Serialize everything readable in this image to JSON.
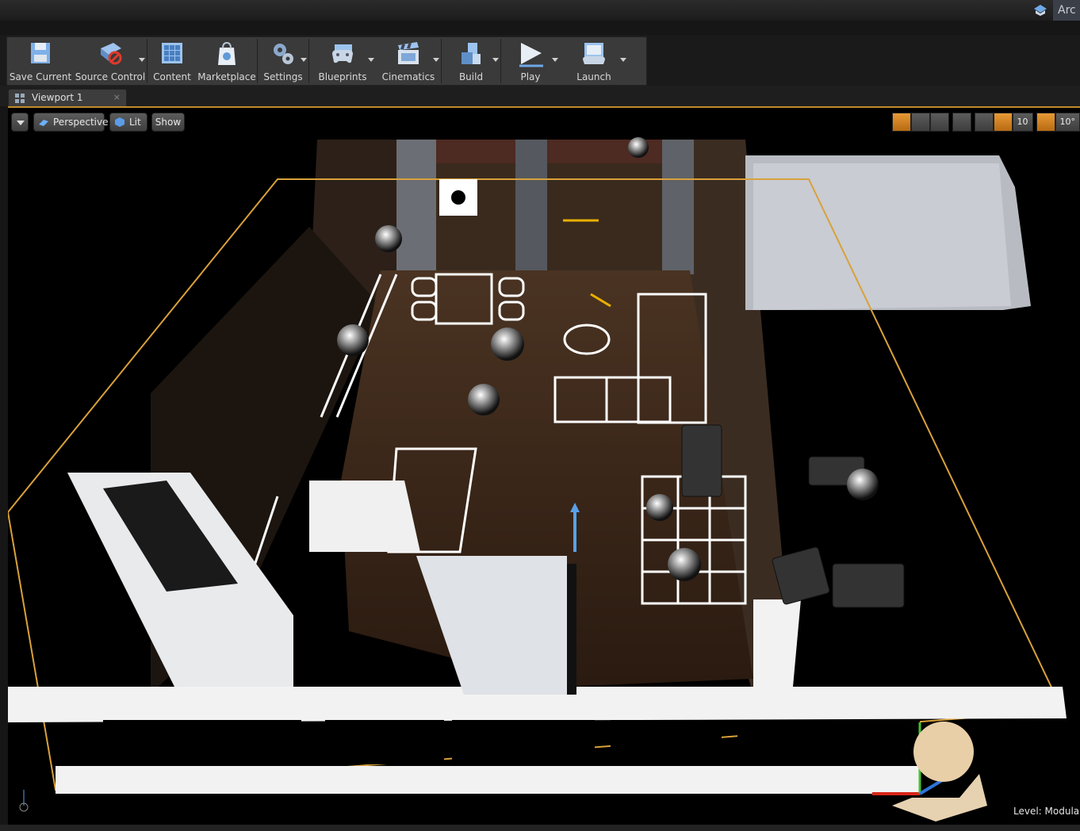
{
  "window": {
    "title_fragment": "Arc"
  },
  "toolbar": {
    "buttons": [
      {
        "label": "Save Current",
        "icon": "floppy-disk-icon",
        "dropdown": false
      },
      {
        "label": "Source Control",
        "icon": "source-control-icon",
        "dropdown": true
      },
      {
        "label": "Content",
        "icon": "content-browser-icon",
        "dropdown": false
      },
      {
        "label": "Marketplace",
        "icon": "marketplace-bag-icon",
        "dropdown": false
      },
      {
        "label": "Settings",
        "icon": "gears-icon",
        "dropdown": true
      },
      {
        "label": "Blueprints",
        "icon": "gamepad-icon",
        "dropdown": true
      },
      {
        "label": "Cinematics",
        "icon": "clapperboard-icon",
        "dropdown": true
      },
      {
        "label": "Build",
        "icon": "build-blocks-icon",
        "dropdown": true
      },
      {
        "label": "Play",
        "icon": "play-icon",
        "dropdown": true
      },
      {
        "label": "Launch",
        "icon": "launch-monitor-icon",
        "dropdown": true
      }
    ]
  },
  "tab": {
    "label": "Viewport 1",
    "close": "×"
  },
  "viewport": {
    "perspective_label": "Perspective",
    "lit_label": "Lit",
    "show_label": "Show",
    "grid_snap": "10",
    "rotation_snap": "10°",
    "level_label": "Level:",
    "level_name": "Modula"
  },
  "colors": {
    "accent": "#e8922a",
    "selection_outline": "#c28a2a",
    "toolbar_bg": "#3a3a3a",
    "viewport_bg": "#000000"
  }
}
